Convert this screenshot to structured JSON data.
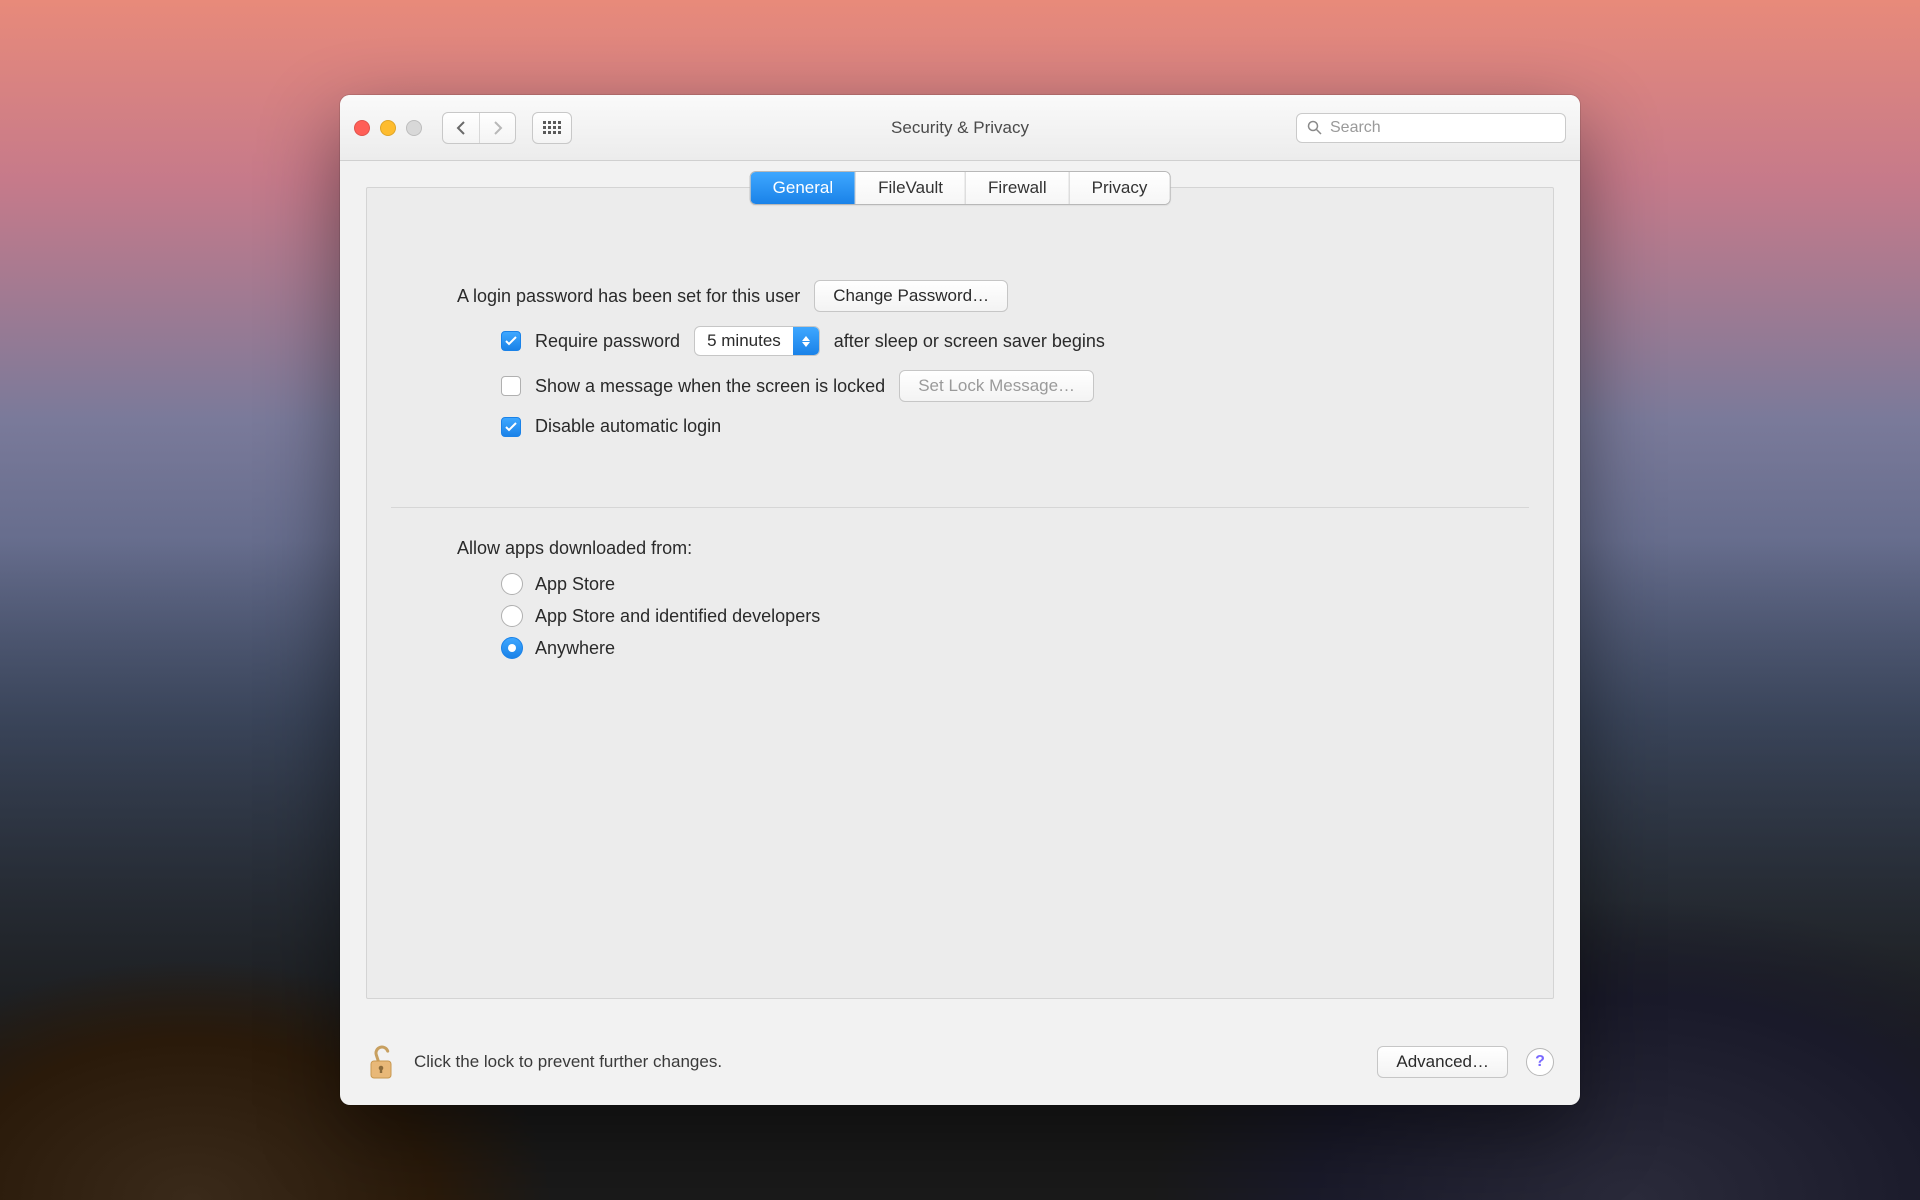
{
  "window": {
    "title": "Security & Privacy"
  },
  "search": {
    "placeholder": "Search"
  },
  "tabs": [
    {
      "label": "General",
      "active": true
    },
    {
      "label": "FileVault",
      "active": false
    },
    {
      "label": "Firewall",
      "active": false
    },
    {
      "label": "Privacy",
      "active": false
    }
  ],
  "password_section": {
    "status_text": "A login password has been set for this user",
    "change_button": "Change Password…",
    "require_password": {
      "checked": true,
      "label_before": "Require password",
      "delay_value": "5 minutes",
      "label_after": "after sleep or screen saver begins"
    },
    "show_message": {
      "checked": false,
      "label": "Show a message when the screen is locked",
      "button": "Set Lock Message…",
      "button_enabled": false
    },
    "disable_auto_login": {
      "checked": true,
      "label": "Disable automatic login"
    }
  },
  "gatekeeper": {
    "heading": "Allow apps downloaded from:",
    "options": [
      {
        "label": "App Store",
        "selected": false
      },
      {
        "label": "App Store and identified developers",
        "selected": false
      },
      {
        "label": "Anywhere",
        "selected": true
      }
    ]
  },
  "footer": {
    "lock_text": "Click the lock to prevent further changes.",
    "advanced_button": "Advanced…",
    "help": "?"
  }
}
